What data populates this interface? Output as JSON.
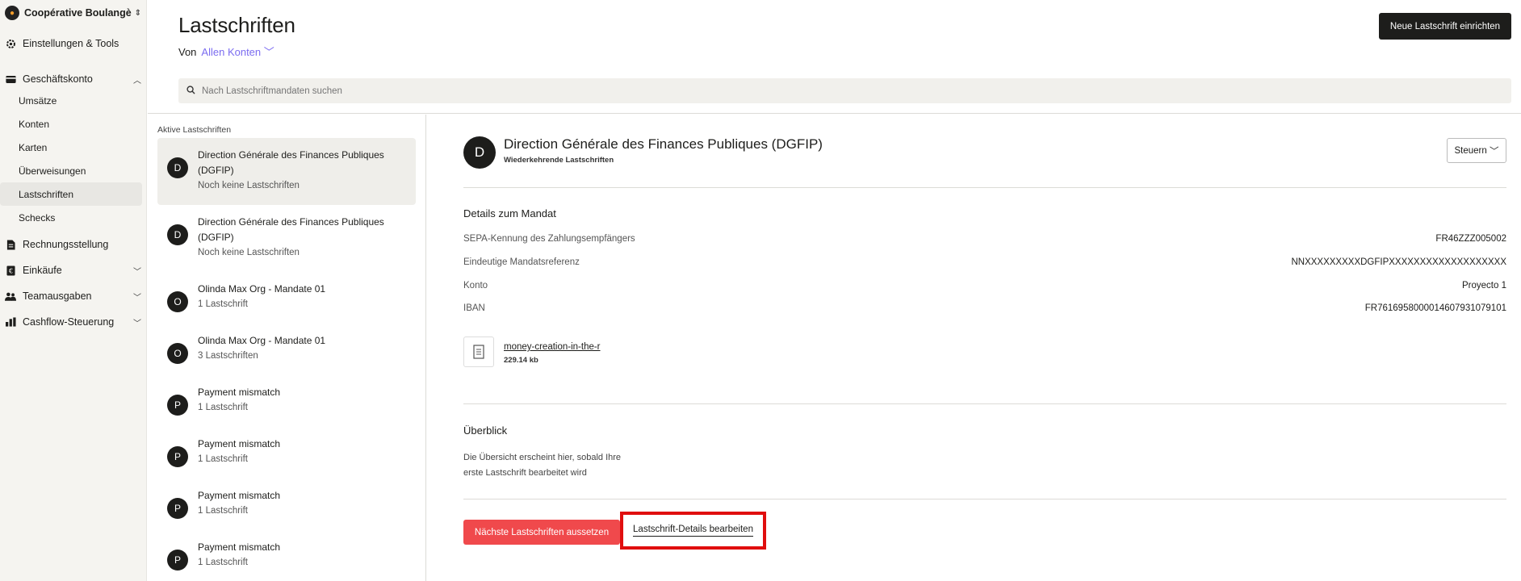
{
  "sidebar": {
    "org_name": "Coopérative Boulangèr...",
    "settings": "Einstellungen & Tools",
    "business": "Geschäftskonto",
    "business_items": [
      "Umsätze",
      "Konten",
      "Karten",
      "Überweisungen",
      "Lastschriften",
      "Schecks"
    ],
    "invoicing": "Rechnungsstellung",
    "purchases": "Einkäufe",
    "team": "Teamausgaben",
    "cashflow": "Cashflow-Steuerung"
  },
  "header": {
    "title": "Lastschriften",
    "from_label": "Von",
    "from_value": "Allen Konten",
    "new_button": "Neue Lastschrift einrichten",
    "search_placeholder": "Nach Lastschriftmandaten suchen"
  },
  "list": {
    "heading": "Aktive Lastschriften",
    "items": [
      {
        "initial": "D",
        "name": "Direction Générale des Finances Publiques (DGFIP)",
        "sub": "Noch keine Lastschriften"
      },
      {
        "initial": "D",
        "name": "Direction Générale des Finances Publiques (DGFIP)",
        "sub": "Noch keine Lastschriften"
      },
      {
        "initial": "O",
        "name": "Olinda Max Org - Mandate 01",
        "sub": "1 Lastschrift"
      },
      {
        "initial": "O",
        "name": "Olinda Max Org - Mandate 01",
        "sub": "3 Lastschriften"
      },
      {
        "initial": "P",
        "name": "Payment mismatch",
        "sub": "1 Lastschrift"
      },
      {
        "initial": "P",
        "name": "Payment mismatch",
        "sub": "1 Lastschrift"
      },
      {
        "initial": "P",
        "name": "Payment mismatch",
        "sub": "1 Lastschrift"
      },
      {
        "initial": "P",
        "name": "Payment mismatch",
        "sub": "1 Lastschrift"
      }
    ]
  },
  "detail": {
    "initial": "D",
    "name": "Direction Générale des Finances Publiques (DGFIP)",
    "type": "Wiederkehrende Lastschriften",
    "category": "Steuern",
    "mandate_title": "Details zum Mandat",
    "rows": [
      {
        "k": "SEPA-Kennung des Zahlungsempfängers",
        "v": "FR46ZZZ005002"
      },
      {
        "k": "Eindeutige Mandatsreferenz",
        "v": "NNXXXXXXXXXDGFIPXXXXXXXXXXXXXXXXXXX"
      },
      {
        "k": "Konto",
        "v": "Proyecto 1"
      },
      {
        "k": "IBAN",
        "v": "FR7616958000014607931079101"
      }
    ],
    "file_name": "money-creation-in-the-r",
    "file_size": "229.14 kb",
    "overview_title": "Überblick",
    "overview_text": "Die Übersicht erscheint hier, sobald Ihre erste Lastschrift bearbeitet wird",
    "pause_button": "Nächste Lastschriften aussetzen",
    "edit_button": "Lastschrift-Details bearbeiten"
  }
}
